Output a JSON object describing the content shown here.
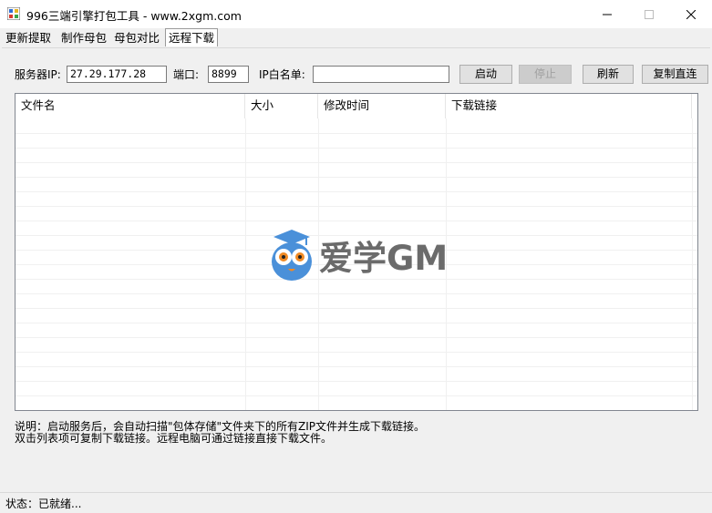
{
  "window": {
    "title": "996三端引擎打包工具 - www.2xgm.com",
    "minimize_icon": "minimize-icon",
    "maximize_icon": "maximize-icon",
    "close_icon": "close-icon"
  },
  "tabs": [
    {
      "label": "更新提取",
      "active": false
    },
    {
      "label": "制作母包",
      "active": false
    },
    {
      "label": "母包对比",
      "active": false
    },
    {
      "label": "远程下载",
      "active": true
    }
  ],
  "form": {
    "server_ip_label": "服务器IP:",
    "server_ip_value": "27.29.177.28",
    "port_label": "端口:",
    "port_value": "8899",
    "whitelist_label": "IP白名单:",
    "whitelist_value": ""
  },
  "buttons": {
    "start": "启动",
    "stop": "停止",
    "refresh": "刷新",
    "copy_direct": "复制直连"
  },
  "table": {
    "columns": [
      "文件名",
      "大小",
      "修改时间",
      "下载链接"
    ],
    "rows": []
  },
  "watermark": {
    "text": "爱学GM"
  },
  "notes": {
    "line1": "说明：启动服务后，会自动扫描\"包体存储\"文件夹下的所有ZIP文件并生成下载链接。",
    "line2": "双击列表项可复制下载链接。远程电脑可通过链接直接下载文件。"
  },
  "status": {
    "text": "状态：已就绪..."
  },
  "colors": {
    "accent": "#0078d7",
    "owl_blue": "#4a90d9",
    "owl_orange": "#f08a24",
    "watermark_gray": "#6b6b6b"
  }
}
